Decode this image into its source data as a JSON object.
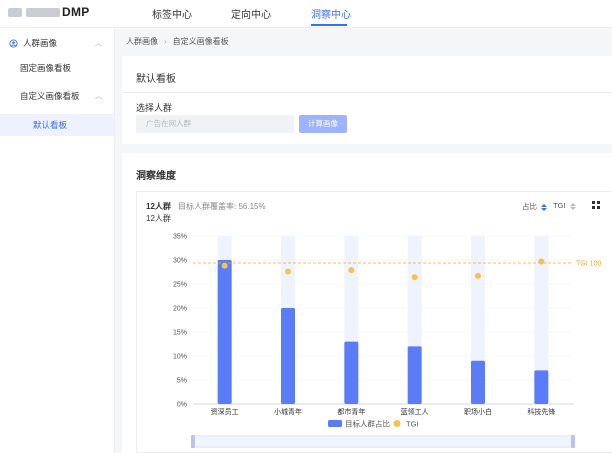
{
  "header": {
    "app_name": "DMP",
    "nav": [
      {
        "label": "标签中心",
        "active": false
      },
      {
        "label": "定向中心",
        "active": false
      },
      {
        "label": "洞察中心",
        "active": true
      }
    ],
    "accent": "#3b6cf6"
  },
  "sidebar": {
    "items": [
      {
        "label": "人群画像",
        "icon": "audience-icon",
        "expanded": true
      },
      {
        "label": "固定画像看板"
      },
      {
        "label": "自定义画像看板",
        "expanded": true
      },
      {
        "label": "默认看板",
        "active": true
      }
    ]
  },
  "breadcrumb": [
    "人群画像",
    "自定义画像看板"
  ],
  "board": {
    "title": "默认看板",
    "select_label": "选择人群",
    "input_placeholder": "广告在网人群",
    "compute_button": "计算画像"
  },
  "insight": {
    "title": "洞察维度",
    "group_name": "12人群",
    "coverage_label": "目标人群覆盖率: 56.15%",
    "sub_label": "12人群",
    "sort_ratio": "占比",
    "sort_tgi": "TGI",
    "tgi_line_label": "TGI 100"
  },
  "chart_data": {
    "type": "bar",
    "categories": [
      "资深员工",
      "小城青年",
      "都市青年",
      "蓝领工人",
      "职场小白",
      "科技先锋"
    ],
    "series": [
      {
        "name": "目标人群占比",
        "values": [
          30,
          20,
          13,
          12,
          9,
          7
        ],
        "color": "#5b7cf8"
      },
      {
        "name": "TGI",
        "values": [
          96,
          92,
          93,
          88,
          89,
          99
        ],
        "color": "#f8c24a"
      }
    ],
    "tgi_reference": 100,
    "y_ticks": [
      "35%",
      "30%",
      "25%",
      "20%",
      "15%",
      "10%",
      "5%",
      "0%"
    ],
    "ylim": [
      0,
      35
    ],
    "legend_position": "bottom",
    "reference_line_color": "#f5a623"
  }
}
